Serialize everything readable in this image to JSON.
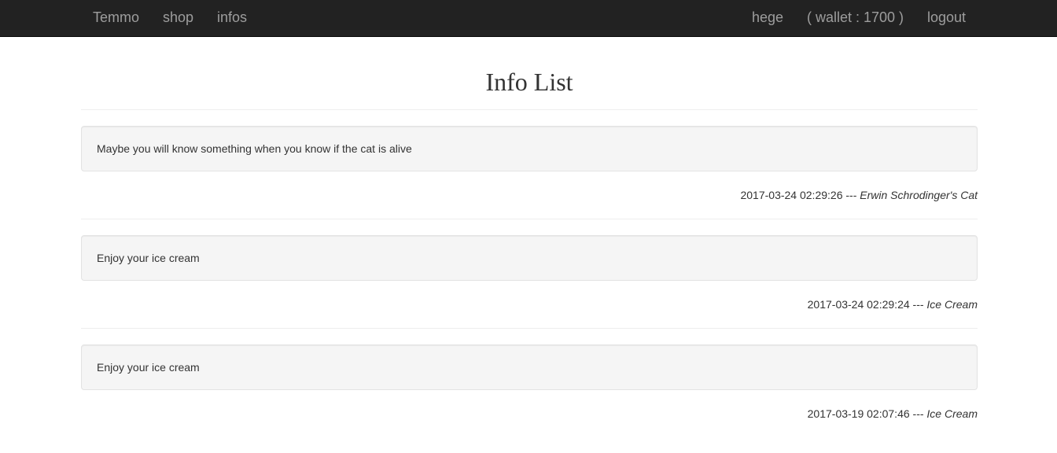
{
  "navbar": {
    "brand": "Temmo",
    "links": [
      "shop",
      "infos"
    ],
    "user": "hege",
    "wallet": "( wallet : 1700 )",
    "logout": "logout"
  },
  "page": {
    "title": "Info List"
  },
  "infos": [
    {
      "text": "Maybe you will know something when you know if the cat is alive",
      "timestamp": "2017-03-24 02:29:26",
      "separator": "---",
      "author": "Erwin Schrodinger's Cat"
    },
    {
      "text": "Enjoy your ice cream",
      "timestamp": "2017-03-24 02:29:24",
      "separator": "---",
      "author": "Ice Cream"
    },
    {
      "text": "Enjoy your ice cream",
      "timestamp": "2017-03-19 02:07:46",
      "separator": "---",
      "author": "Ice Cream"
    }
  ],
  "colors": {
    "navbar_bg": "#222222",
    "navbar_text": "#9d9d9d",
    "well_bg": "#f5f5f5",
    "text": "#333333"
  }
}
